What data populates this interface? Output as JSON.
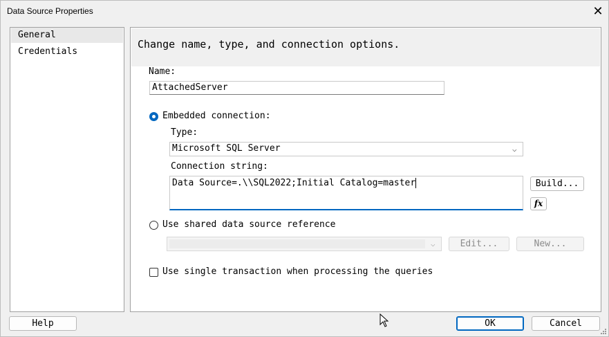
{
  "window": {
    "title": "Data Source Properties",
    "close_glyph": "✕"
  },
  "nav": {
    "items": [
      {
        "label": "General",
        "selected": true
      },
      {
        "label": "Credentials",
        "selected": false
      }
    ]
  },
  "panel": {
    "header": "Change name, type, and connection options.",
    "name_label": "Name:",
    "name_value": "AttachedServer",
    "embedded": {
      "label": "Embedded connection:",
      "selected": true,
      "type_label": "Type:",
      "type_value": "Microsoft SQL Server",
      "conn_label": "Connection string:",
      "conn_value": "Data Source=.\\\\SQL2022;Initial Catalog=master",
      "build_button": "Build...",
      "fx_button": "fx"
    },
    "shared": {
      "label": "Use shared data source reference",
      "selected": false,
      "value": "",
      "edit_button": "Edit...",
      "new_button": "New..."
    },
    "single_transaction": {
      "label": "Use single transaction when processing the queries",
      "checked": false
    }
  },
  "footer": {
    "help": "Help",
    "ok": "OK",
    "cancel": "Cancel"
  }
}
